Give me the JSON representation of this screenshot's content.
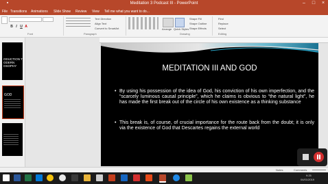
{
  "window": {
    "title": "Meditation 3 Podcast III - PowerPoint"
  },
  "tabs": [
    "File",
    "Transitions",
    "Animations",
    "Slide Show",
    "Review",
    "View",
    "Tell me what you want to do..."
  ],
  "ribbon": {
    "groups": [
      "Font",
      "Paragraph",
      "Drawing",
      "Editing"
    ],
    "paragraph_items": [
      "Text Direction",
      "Align Text",
      "Convert to SmartArt"
    ],
    "drawing_items": [
      "Arrange",
      "Quick Styles",
      "Shape Fill",
      "Shape Outline",
      "Shape Effects"
    ],
    "editing_items": [
      "Find",
      "Replace",
      "Select"
    ]
  },
  "thumbnails": [
    {
      "number": "4",
      "text": "ODUCTION TO\nODERN\nOSOPHY"
    },
    {
      "number": "5",
      "text": "GOD"
    },
    {
      "number": "6",
      "text": ""
    }
  ],
  "slide": {
    "title": "MEDITATION III AND GOD",
    "bullets": [
      "By using his possession of the idea of God, his conviction of his own imperfection, and the “scarcely luminous causal principle”, which he claims is obvious to “the natural light”, he has made the first break out of the circle of his own existence as a thinking substance",
      "This break is, of course, of crucial importance for the route back from the doubt; it is only via the existence of God that Descartes regains the external world"
    ]
  },
  "status": {
    "notes": "Notes",
    "comments": "Comments"
  },
  "taskbar": {
    "time": "9:25",
    "date": "04/01/2019"
  },
  "colors": {
    "accent": "#b7472a",
    "slide_bg": "#000000",
    "record": "#d32f2f"
  }
}
